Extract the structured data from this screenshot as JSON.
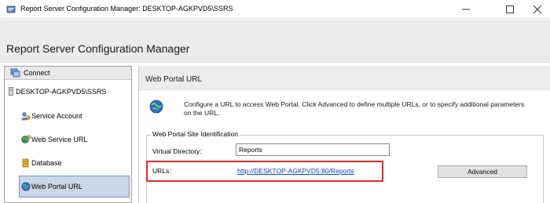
{
  "window": {
    "title": "Report Server Configuration Manager: DESKTOP-AGKPVD5\\SSRS",
    "minimize": "—",
    "maximize": "☐",
    "close": "✕"
  },
  "header": {
    "title": "Report Server Configuration Manager"
  },
  "sidebar": {
    "connect_label": "Connect",
    "server_name": "DESKTOP-AGKPVD5\\SSRS",
    "items": [
      {
        "label": "Service Account",
        "icon": "service-account-icon"
      },
      {
        "label": "Web Service URL",
        "icon": "web-service-icon"
      },
      {
        "label": "Database",
        "icon": "database-icon"
      },
      {
        "label": "Web Portal URL",
        "icon": "web-portal-icon",
        "selected": true
      }
    ]
  },
  "main": {
    "title": "Web Portal URL",
    "description": "Configure a URL to access Web Portal.  Click Advanced to define multiple URLs, or to specify additional parameters on the URL.",
    "group_title": "Web Portal Site Identification",
    "virtual_directory_label": "Virtual Directory:",
    "virtual_directory_value": "Reports",
    "urls_label": "URLs:",
    "url_value": "http://DESKTOP-AGKPVD5:80/Reports",
    "advanced_button": "Advanced"
  },
  "colors": {
    "highlight_border": "#e02a2a",
    "link": "#0645c8",
    "selected_bg": "#cbd6e8"
  }
}
